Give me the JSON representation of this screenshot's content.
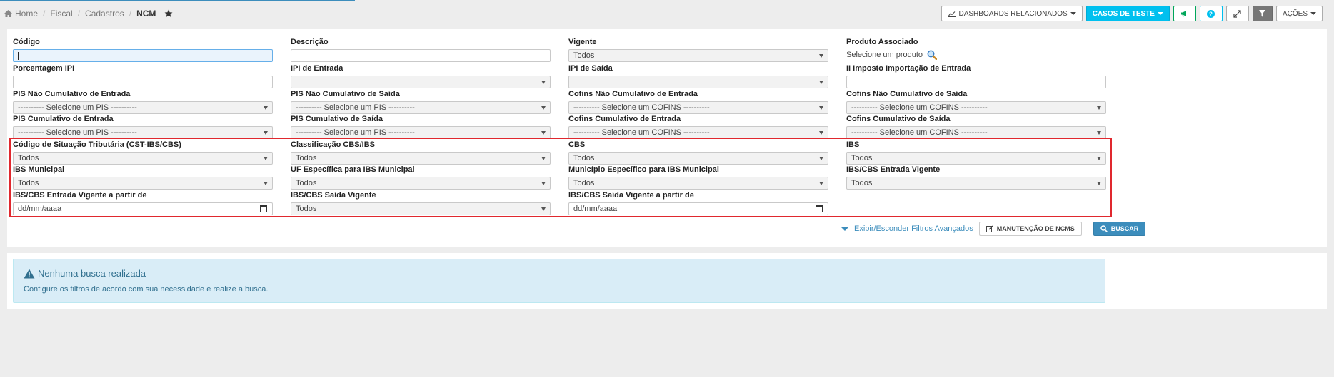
{
  "breadcrumb": [
    "Home",
    "Fiscal",
    "Cadastros",
    "NCM"
  ],
  "toolbar": {
    "dashboards": "DASHBOARDS RELACIONADOS",
    "test_cases": "CASOS DE TESTE",
    "actions": "AÇÕES"
  },
  "fields": {
    "codigo": {
      "label": "Código",
      "value": ""
    },
    "descricao": {
      "label": "Descrição",
      "value": ""
    },
    "vigente": {
      "label": "Vigente",
      "value": "Todos"
    },
    "produto": {
      "label": "Produto Associado",
      "value": "Selecione um produto"
    },
    "porc_ipi": {
      "label": "Porcentagem IPI",
      "value": ""
    },
    "ipi_entrada": {
      "label": "IPI de Entrada",
      "value": ""
    },
    "ipi_saida": {
      "label": "IPI de Saída",
      "value": ""
    },
    "ii_import": {
      "label": "II Imposto Importação de Entrada",
      "value": ""
    },
    "pis_nc_ent": {
      "label": "PIS Não Cumulativo de Entrada",
      "value": "---------- Selecione um PIS ----------"
    },
    "pis_nc_sai": {
      "label": "PIS Não Cumulativo de Saída",
      "value": "---------- Selecione um PIS ----------"
    },
    "cof_nc_ent": {
      "label": "Cofins Não Cumulativo de Entrada",
      "value": "---------- Selecione um COFINS ----------"
    },
    "cof_nc_sai": {
      "label": "Cofins Não Cumulativo de Saída",
      "value": "---------- Selecione um COFINS ----------"
    },
    "pis_c_ent": {
      "label": "PIS Cumulativo de Entrada",
      "value": "---------- Selecione um PIS ----------"
    },
    "pis_c_sai": {
      "label": "PIS Cumulativo de Saída",
      "value": "---------- Selecione um PIS ----------"
    },
    "cof_c_ent": {
      "label": "Cofins Cumulativo de Entrada",
      "value": "---------- Selecione um COFINS ----------"
    },
    "cof_c_sai": {
      "label": "Cofins Cumulativo de Saída",
      "value": "---------- Selecione um COFINS ----------"
    },
    "cst_ibs": {
      "label": "Código de Situação Tributária (CST-IBS/CBS)",
      "value": "Todos"
    },
    "class_cbs": {
      "label": "Classificação CBS/IBS",
      "value": "Todos"
    },
    "cbs": {
      "label": "CBS",
      "value": "Todos"
    },
    "ibs": {
      "label": "IBS",
      "value": "Todos"
    },
    "ibs_mun": {
      "label": "IBS Municipal",
      "value": "Todos"
    },
    "uf_ibs_mun": {
      "label": "UF Específica para IBS Municipal",
      "value": "Todos"
    },
    "mun_ibs_mun": {
      "label": "Município Específico para IBS Municipal",
      "value": "Todos"
    },
    "ent_vig": {
      "label": "IBS/CBS Entrada Vigente",
      "value": "Todos"
    },
    "ent_vig_de": {
      "label": "IBS/CBS Entrada Vigente a partir de",
      "value": "dd/mm/aaaa"
    },
    "sai_vig": {
      "label": "IBS/CBS Saída Vigente",
      "value": "Todos"
    },
    "sai_vig_de": {
      "label": "IBS/CBS Saída Vigente a partir de",
      "value": "dd/mm/aaaa"
    }
  },
  "actions": {
    "advanced": "Exibir/Esconder Filtros Avançados",
    "maintenance": "MANUTENÇÃO DE NCMS",
    "search": "BUSCAR"
  },
  "alert": {
    "title": "Nenhuma busca realizada",
    "message": "Configure os filtros de acordo com sua necessidade e realize a busca."
  },
  "colors": {
    "primary": "#3c8dbc",
    "teal": "#00c0ef",
    "highlight": "#e0282e",
    "info_bg": "#d9edf7"
  }
}
